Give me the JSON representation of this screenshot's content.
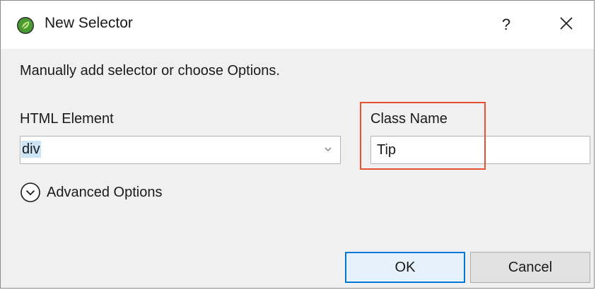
{
  "window": {
    "title": "New Selector",
    "help_label": "?"
  },
  "intro": {
    "text": "Manually add selector or choose Options."
  },
  "html_element": {
    "label": "HTML Element",
    "value": "div"
  },
  "class_name": {
    "label": "Class Name",
    "value": "Tip"
  },
  "advanced": {
    "label": "Advanced Options"
  },
  "buttons": {
    "ok_label": "OK",
    "cancel_label": "Cancel"
  },
  "colors": {
    "highlight_border": "#e8512f",
    "default_button_border": "#0078d7",
    "selection_background": "#cce4f7",
    "app_icon_green": "#3f8f2f"
  },
  "icons": {
    "app": "leaf-app-icon",
    "help": "question-mark",
    "close": "close-x",
    "dropdown": "chevron-down",
    "advanced": "circle-chevron-down"
  }
}
